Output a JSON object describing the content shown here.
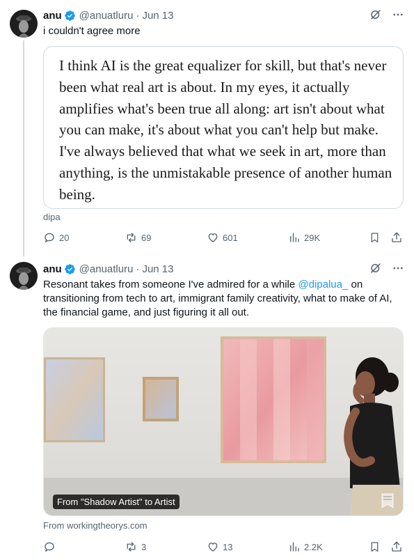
{
  "tweets": [
    {
      "author_name": "anu",
      "handle": "@anuatluru",
      "date": "Jun 13",
      "text": "i couldn't agree more",
      "quote_text": "I think AI is the great equalizer for skill, but that's never been what real art is about. In my eyes, it actually amplifies what's been true all along: art isn't about what you can make, it's about what you can't help but make. I've always believed that what we seek in art, more than anything, is the unmistakable presence of another human being.",
      "source": "dipa",
      "replies": "20",
      "reposts": "69",
      "likes": "601",
      "views": "29K"
    },
    {
      "author_name": "anu",
      "handle": "@anuatluru",
      "date": "Jun 13",
      "text_before": "Resonant takes from someone I've admired for a while ",
      "mention": "@dipalua_",
      "text_after": " on transitioning from tech to art, immigrant family creativity, what to make of AI, the financial game, and just figuring it all out.",
      "media_caption": "From \"Shadow Artist\" to Artist",
      "source": "From workingtheorys.com",
      "replies": "",
      "reposts": "3",
      "likes": "13",
      "views": "2.2K"
    }
  ],
  "colors": {
    "accent": "#1d9bf0",
    "muted": "#536471",
    "text": "#0f1419"
  },
  "icons": [
    "verified-badge-icon",
    "grok-icon",
    "more-icon",
    "reply-icon",
    "repost-icon",
    "like-icon",
    "views-icon",
    "bookmark-icon",
    "share-icon"
  ]
}
